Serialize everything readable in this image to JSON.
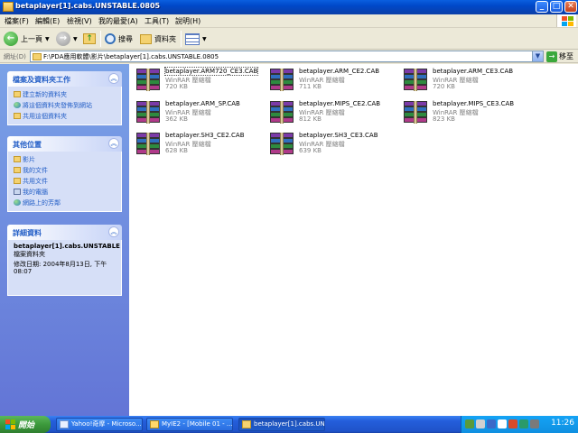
{
  "window": {
    "title": "betaplayer[1].cabs.UNSTABLE.0805",
    "buttons": {
      "minimize": "_",
      "maximize": "□",
      "close": "✕"
    }
  },
  "menu": [
    "檔案(F)",
    "編輯(E)",
    "檢視(V)",
    "我的最愛(A)",
    "工具(T)",
    "說明(H)"
  ],
  "toolbar": {
    "back_label": "上一頁",
    "search_label": "搜尋",
    "folders_label": "資料夾"
  },
  "address": {
    "label": "網址(D)",
    "value": "F:\\PDA應用軟體\\影片\\betaplayer[1].cabs.UNSTABLE.0805",
    "go_label": "移至"
  },
  "tasks": {
    "title": "檔案及資料夾工作",
    "items": [
      "建立新的資料夾",
      "將這個資料夾發佈到網站",
      "共用這個資料夾"
    ]
  },
  "places": {
    "title": "其他位置",
    "items": [
      "影片",
      "我的文件",
      "共用文件",
      "我的電腦",
      "網路上的芳鄰"
    ]
  },
  "details": {
    "title": "詳細資料",
    "name": "betaplayer[1].cabs.UNSTABLE",
    "type": "檔案資料夾",
    "modified": "修改日期: 2004年8月13日, 下午 08:07"
  },
  "files": [
    {
      "name": "betaplayer.ARM720_CE3.CAB",
      "type": "WinRAR 壓縮檔",
      "size": "720 KB",
      "selected": true
    },
    {
      "name": "betaplayer.ARM_CE2.CAB",
      "type": "WinRAR 壓縮檔",
      "size": "711 KB"
    },
    {
      "name": "betaplayer.ARM_CE3.CAB",
      "type": "WinRAR 壓縮檔",
      "size": "720 KB"
    },
    {
      "name": "betaplayer.ARM_SP.CAB",
      "type": "WinRAR 壓縮檔",
      "size": "362 KB"
    },
    {
      "name": "betaplayer.MIPS_CE2.CAB",
      "type": "WinRAR 壓縮檔",
      "size": "812 KB"
    },
    {
      "name": "betaplayer.MIPS_CE3.CAB",
      "type": "WinRAR 壓縮檔",
      "size": "823 KB"
    },
    {
      "name": "betaplayer.SH3_CE2.CAB",
      "type": "WinRAR 壓縮檔",
      "size": "628 KB"
    },
    {
      "name": "betaplayer.SH3_CE3.CAB",
      "type": "WinRAR 壓縮檔",
      "size": "639 KB"
    }
  ],
  "taskbar": {
    "start_label": "開始",
    "items": [
      "Yahoo!奇摩 - Microso...",
      "MyIE2 - [Mobile 01 - ...",
      "betaplayer[1].cabs.UN..."
    ],
    "clock": "11:26"
  }
}
